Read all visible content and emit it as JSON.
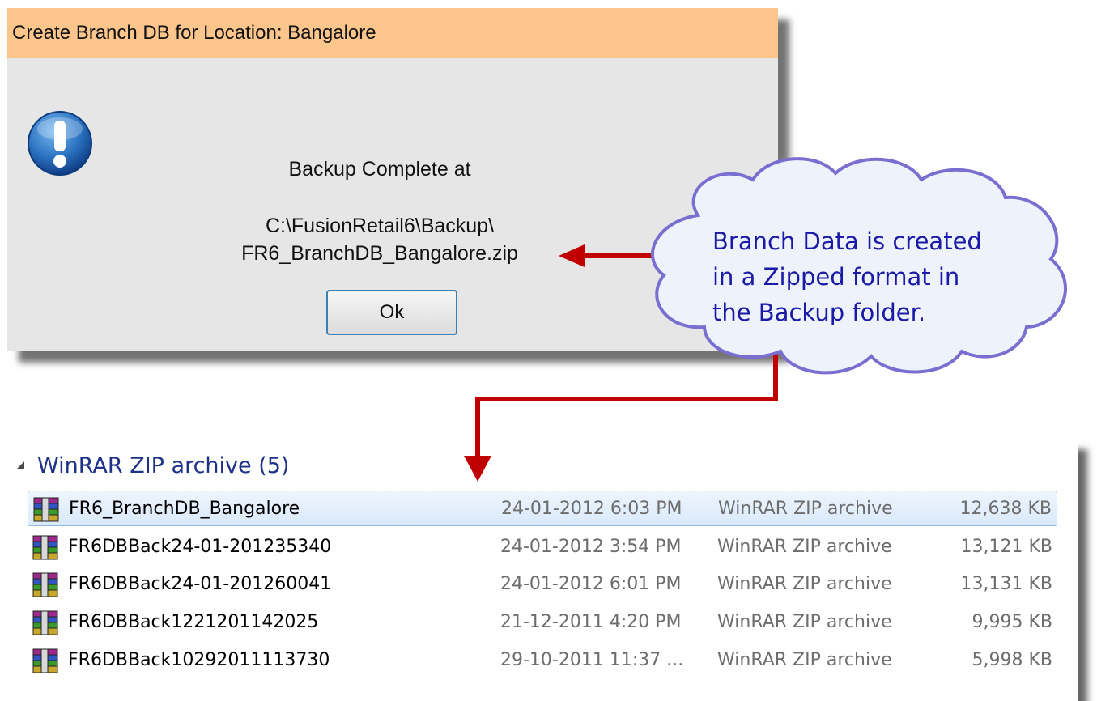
{
  "dialog": {
    "title": "Create Branch DB for Location: Bangalore",
    "icon": "info-exclamation-icon",
    "message_line1": "Backup Complete at",
    "message_line2": "C:\\FusionRetail6\\Backup\\",
    "message_line3": "FR6_BranchDB_Bangalore.zip",
    "ok_label": "Ok"
  },
  "callout": {
    "lines": [
      "Branch Data is created",
      "in a Zipped format in",
      "the Backup folder."
    ],
    "text_color": "#1a1aa6",
    "arrow_color": "#c00000"
  },
  "explorer": {
    "group_label": "WinRAR ZIP archive (5)",
    "rows": [
      {
        "name": "FR6_BranchDB_Bangalore",
        "date": "24-01-2012 6:03 PM",
        "type": "WinRAR ZIP archive",
        "size": "12,638 KB",
        "selected": true
      },
      {
        "name": "FR6DBBack24-01-201235340",
        "date": "24-01-2012 3:54 PM",
        "type": "WinRAR ZIP archive",
        "size": "13,121 KB",
        "selected": false
      },
      {
        "name": "FR6DBBack24-01-201260041",
        "date": "24-01-2012 6:01 PM",
        "type": "WinRAR ZIP archive",
        "size": "13,131 KB",
        "selected": false
      },
      {
        "name": "FR6DBBack1221201142025",
        "date": "21-12-2011 4:20 PM",
        "type": "WinRAR ZIP archive",
        "size": "9,995 KB",
        "selected": false
      },
      {
        "name": "FR6DBBack10292011113730",
        "date": "29-10-2011 11:37 ...",
        "type": "WinRAR ZIP archive",
        "size": "5,998 KB",
        "selected": false
      }
    ]
  }
}
